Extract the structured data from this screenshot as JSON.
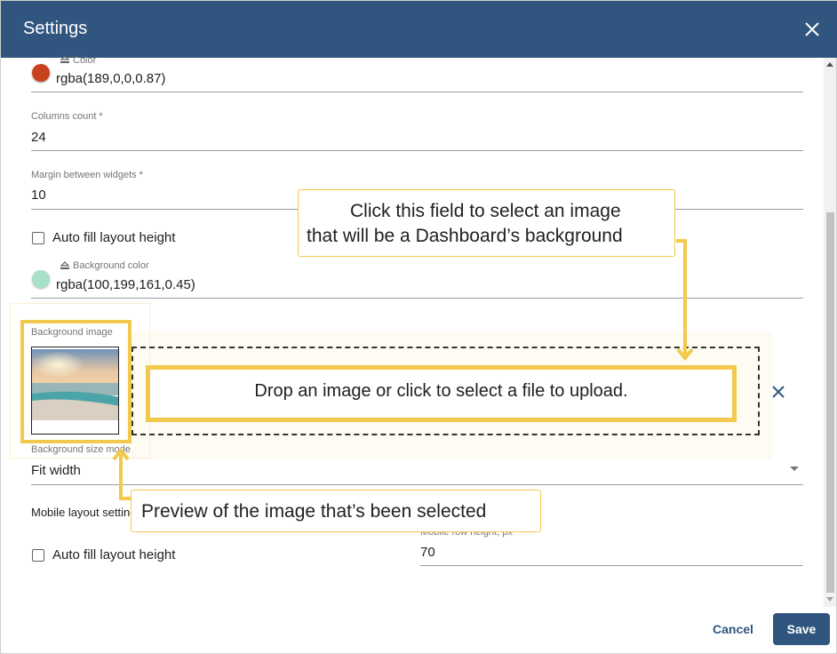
{
  "dialog": {
    "title": "Settings"
  },
  "fields": {
    "color": {
      "label": "Color",
      "value": "rgba(189,0,0,0.87)",
      "swatch": "#c9411c"
    },
    "columns_count": {
      "label": "Columns count *",
      "value": "24"
    },
    "margin": {
      "label": "Margin between widgets *",
      "value": "10"
    },
    "auto_fill": {
      "label": "Auto fill layout height"
    },
    "background_color": {
      "label": "Background color",
      "value": "rgba(100,199,161,0.45)",
      "swatch": "#a9e0c8"
    },
    "background_image": {
      "label": "Background image",
      "drop_text": "Drop an image or click to select a file to upload."
    },
    "background_size_mode": {
      "label": "Background size mode",
      "value": "Fit width"
    },
    "mobile_layout": {
      "label": "Mobile layout settings"
    },
    "mobile_auto_fill": {
      "label": "Auto fill layout height"
    },
    "mobile_row_height": {
      "label": "Mobile row height, px",
      "value": "70"
    }
  },
  "callouts": {
    "top_line1": "Click this field to select an image",
    "top_line2": "that will be a Dashboard’s background",
    "bottom": "Preview of the image that’s been selected"
  },
  "buttons": {
    "cancel": "Cancel",
    "save": "Save"
  },
  "colors": {
    "primary": "#305680",
    "highlight": "#f2c94c"
  }
}
